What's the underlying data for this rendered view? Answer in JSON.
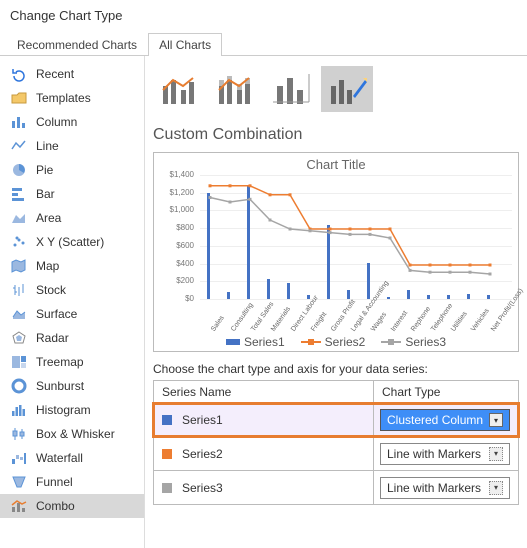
{
  "window": {
    "title": "Change Chart Type"
  },
  "tabs": {
    "recommended": "Recommended Charts",
    "all": "All Charts",
    "active": "all"
  },
  "sidebar": {
    "items": [
      {
        "id": "recent",
        "label": "Recent"
      },
      {
        "id": "templates",
        "label": "Templates"
      },
      {
        "id": "column",
        "label": "Column"
      },
      {
        "id": "line",
        "label": "Line"
      },
      {
        "id": "pie",
        "label": "Pie"
      },
      {
        "id": "bar",
        "label": "Bar"
      },
      {
        "id": "area",
        "label": "Area"
      },
      {
        "id": "xy",
        "label": "X Y (Scatter)"
      },
      {
        "id": "map",
        "label": "Map"
      },
      {
        "id": "stock",
        "label": "Stock"
      },
      {
        "id": "surface",
        "label": "Surface"
      },
      {
        "id": "radar",
        "label": "Radar"
      },
      {
        "id": "treemap",
        "label": "Treemap"
      },
      {
        "id": "sunburst",
        "label": "Sunburst"
      },
      {
        "id": "histogram",
        "label": "Histogram"
      },
      {
        "id": "boxwhisker",
        "label": "Box & Whisker"
      },
      {
        "id": "waterfall",
        "label": "Waterfall"
      },
      {
        "id": "funnel",
        "label": "Funnel"
      },
      {
        "id": "combo",
        "label": "Combo"
      }
    ],
    "selected": "combo"
  },
  "panel": {
    "title": "Custom Combination"
  },
  "preview": {
    "title": "Chart Title"
  },
  "legend": {
    "s1": "Series1",
    "s2": "Series2",
    "s3": "Series3"
  },
  "series_section": {
    "label": "Choose the chart type and axis for your data series:",
    "headers": {
      "name": "Series Name",
      "type": "Chart Type"
    },
    "rows": [
      {
        "name": "Series1",
        "chart_type": "Clustered Column",
        "color": "#4472c4",
        "highlighted": true
      },
      {
        "name": "Series2",
        "chart_type": "Line with Markers",
        "color": "#ed7d31",
        "highlighted": false
      },
      {
        "name": "Series3",
        "chart_type": "Line with Markers",
        "color": "#a5a5a5",
        "highlighted": false
      }
    ]
  },
  "chart_data": {
    "type": "combo",
    "title": "Chart Title",
    "ylabel": "",
    "xlabel": "",
    "ylim": [
      0,
      1400
    ],
    "y_ticks": [
      0,
      200,
      400,
      600,
      800,
      1000,
      1200,
      1400
    ],
    "categories": [
      "Sales",
      "Consulting",
      "Total Sales",
      "Materials",
      "Direct Labour",
      "Freight",
      "Gross Profit",
      "Legal & Accounting",
      "Wages",
      "Interest",
      "Rephone",
      "Telephone",
      "Utilities",
      "Vehicles",
      "Net Profit/(Loss)"
    ],
    "series": [
      {
        "name": "Series1",
        "type": "bar",
        "color": "#4472c4",
        "values": [
          1180,
          80,
          1260,
          220,
          180,
          40,
          820,
          100,
          400,
          20,
          100,
          50,
          50,
          60,
          40
        ]
      },
      {
        "name": "Series2",
        "type": "line",
        "color": "#ed7d31",
        "values": [
          1280,
          1280,
          1280,
          1180,
          1180,
          800,
          800,
          800,
          800,
          800,
          400,
          400,
          400,
          400,
          400
        ]
      },
      {
        "name": "Series3",
        "type": "line",
        "color": "#a5a5a5",
        "values": [
          1150,
          1100,
          1130,
          900,
          800,
          780,
          760,
          740,
          740,
          700,
          340,
          320,
          320,
          320,
          300
        ]
      }
    ],
    "legend_position": "bottom"
  }
}
